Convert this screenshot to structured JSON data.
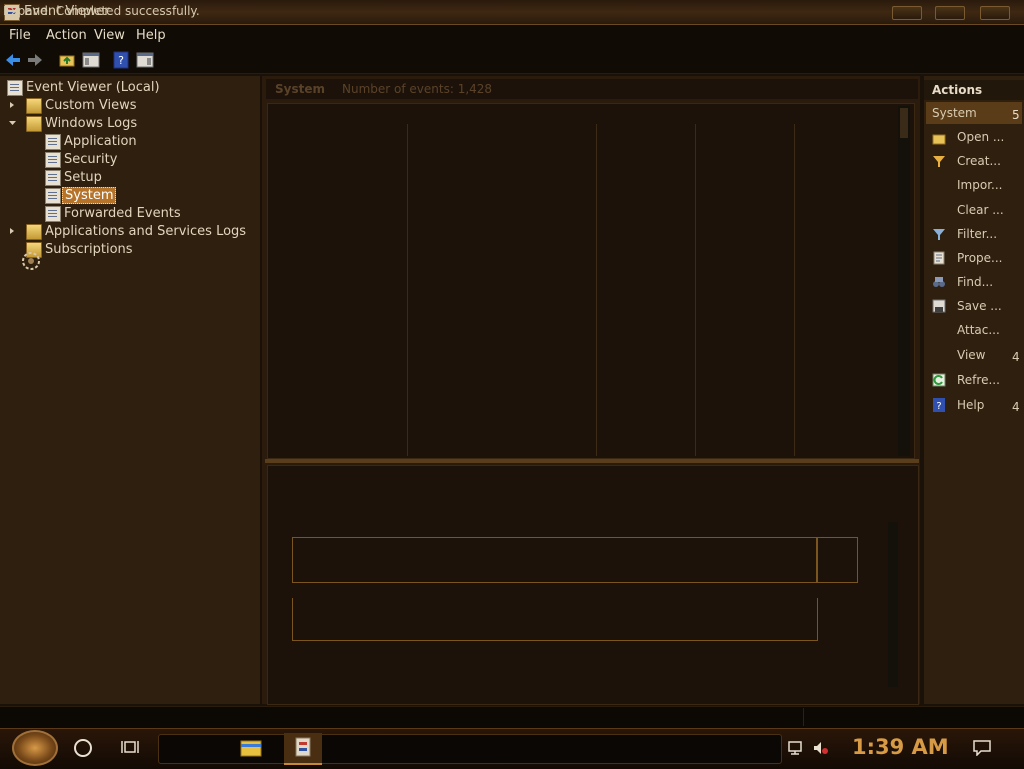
{
  "window": {
    "title": "Event Viewer"
  },
  "menu": [
    "File",
    "Action",
    "View",
    "Help"
  ],
  "tree": {
    "root": "Event Viewer (Local)",
    "custom_views": "Custom Views",
    "windows_logs": "Windows Logs",
    "logs": [
      "Application",
      "Security",
      "Setup",
      "System",
      "Forwarded Events"
    ],
    "apps_services": "Applications and Services Logs",
    "subscriptions": "Subscriptions",
    "selected": "System"
  },
  "center": {
    "log_name": "System",
    "event_count": "Number of events: 1,428"
  },
  "actions": {
    "title": "Actions",
    "section": "System",
    "section_badge": "5",
    "items": [
      {
        "label": "Open ...",
        "icon": "folder-open-icon"
      },
      {
        "label": "Creat...",
        "icon": "filter-create-icon"
      },
      {
        "label": "Impor...",
        "icon": ""
      },
      {
        "label": "Clear ...",
        "icon": ""
      },
      {
        "label": "Filter...",
        "icon": "filter-icon"
      },
      {
        "label": "Prope...",
        "icon": "properties-icon"
      },
      {
        "label": "Find...",
        "icon": "binoculars-icon"
      },
      {
        "label": "Save ...",
        "icon": "save-icon"
      },
      {
        "label": "Attac...",
        "icon": ""
      },
      {
        "label": "View",
        "icon": "",
        "badge": "4"
      },
      {
        "label": "Refre...",
        "icon": "refresh-icon"
      },
      {
        "label": "Help",
        "icon": "help-icon",
        "badge": "4"
      }
    ]
  },
  "status": {
    "text": "Expand:  Completed successfully."
  },
  "taskbar": {
    "clock": "1:39 AM"
  },
  "colors": {
    "accent": "#d79a45",
    "selection": "#b5742a",
    "background": "#2e1f0f"
  }
}
